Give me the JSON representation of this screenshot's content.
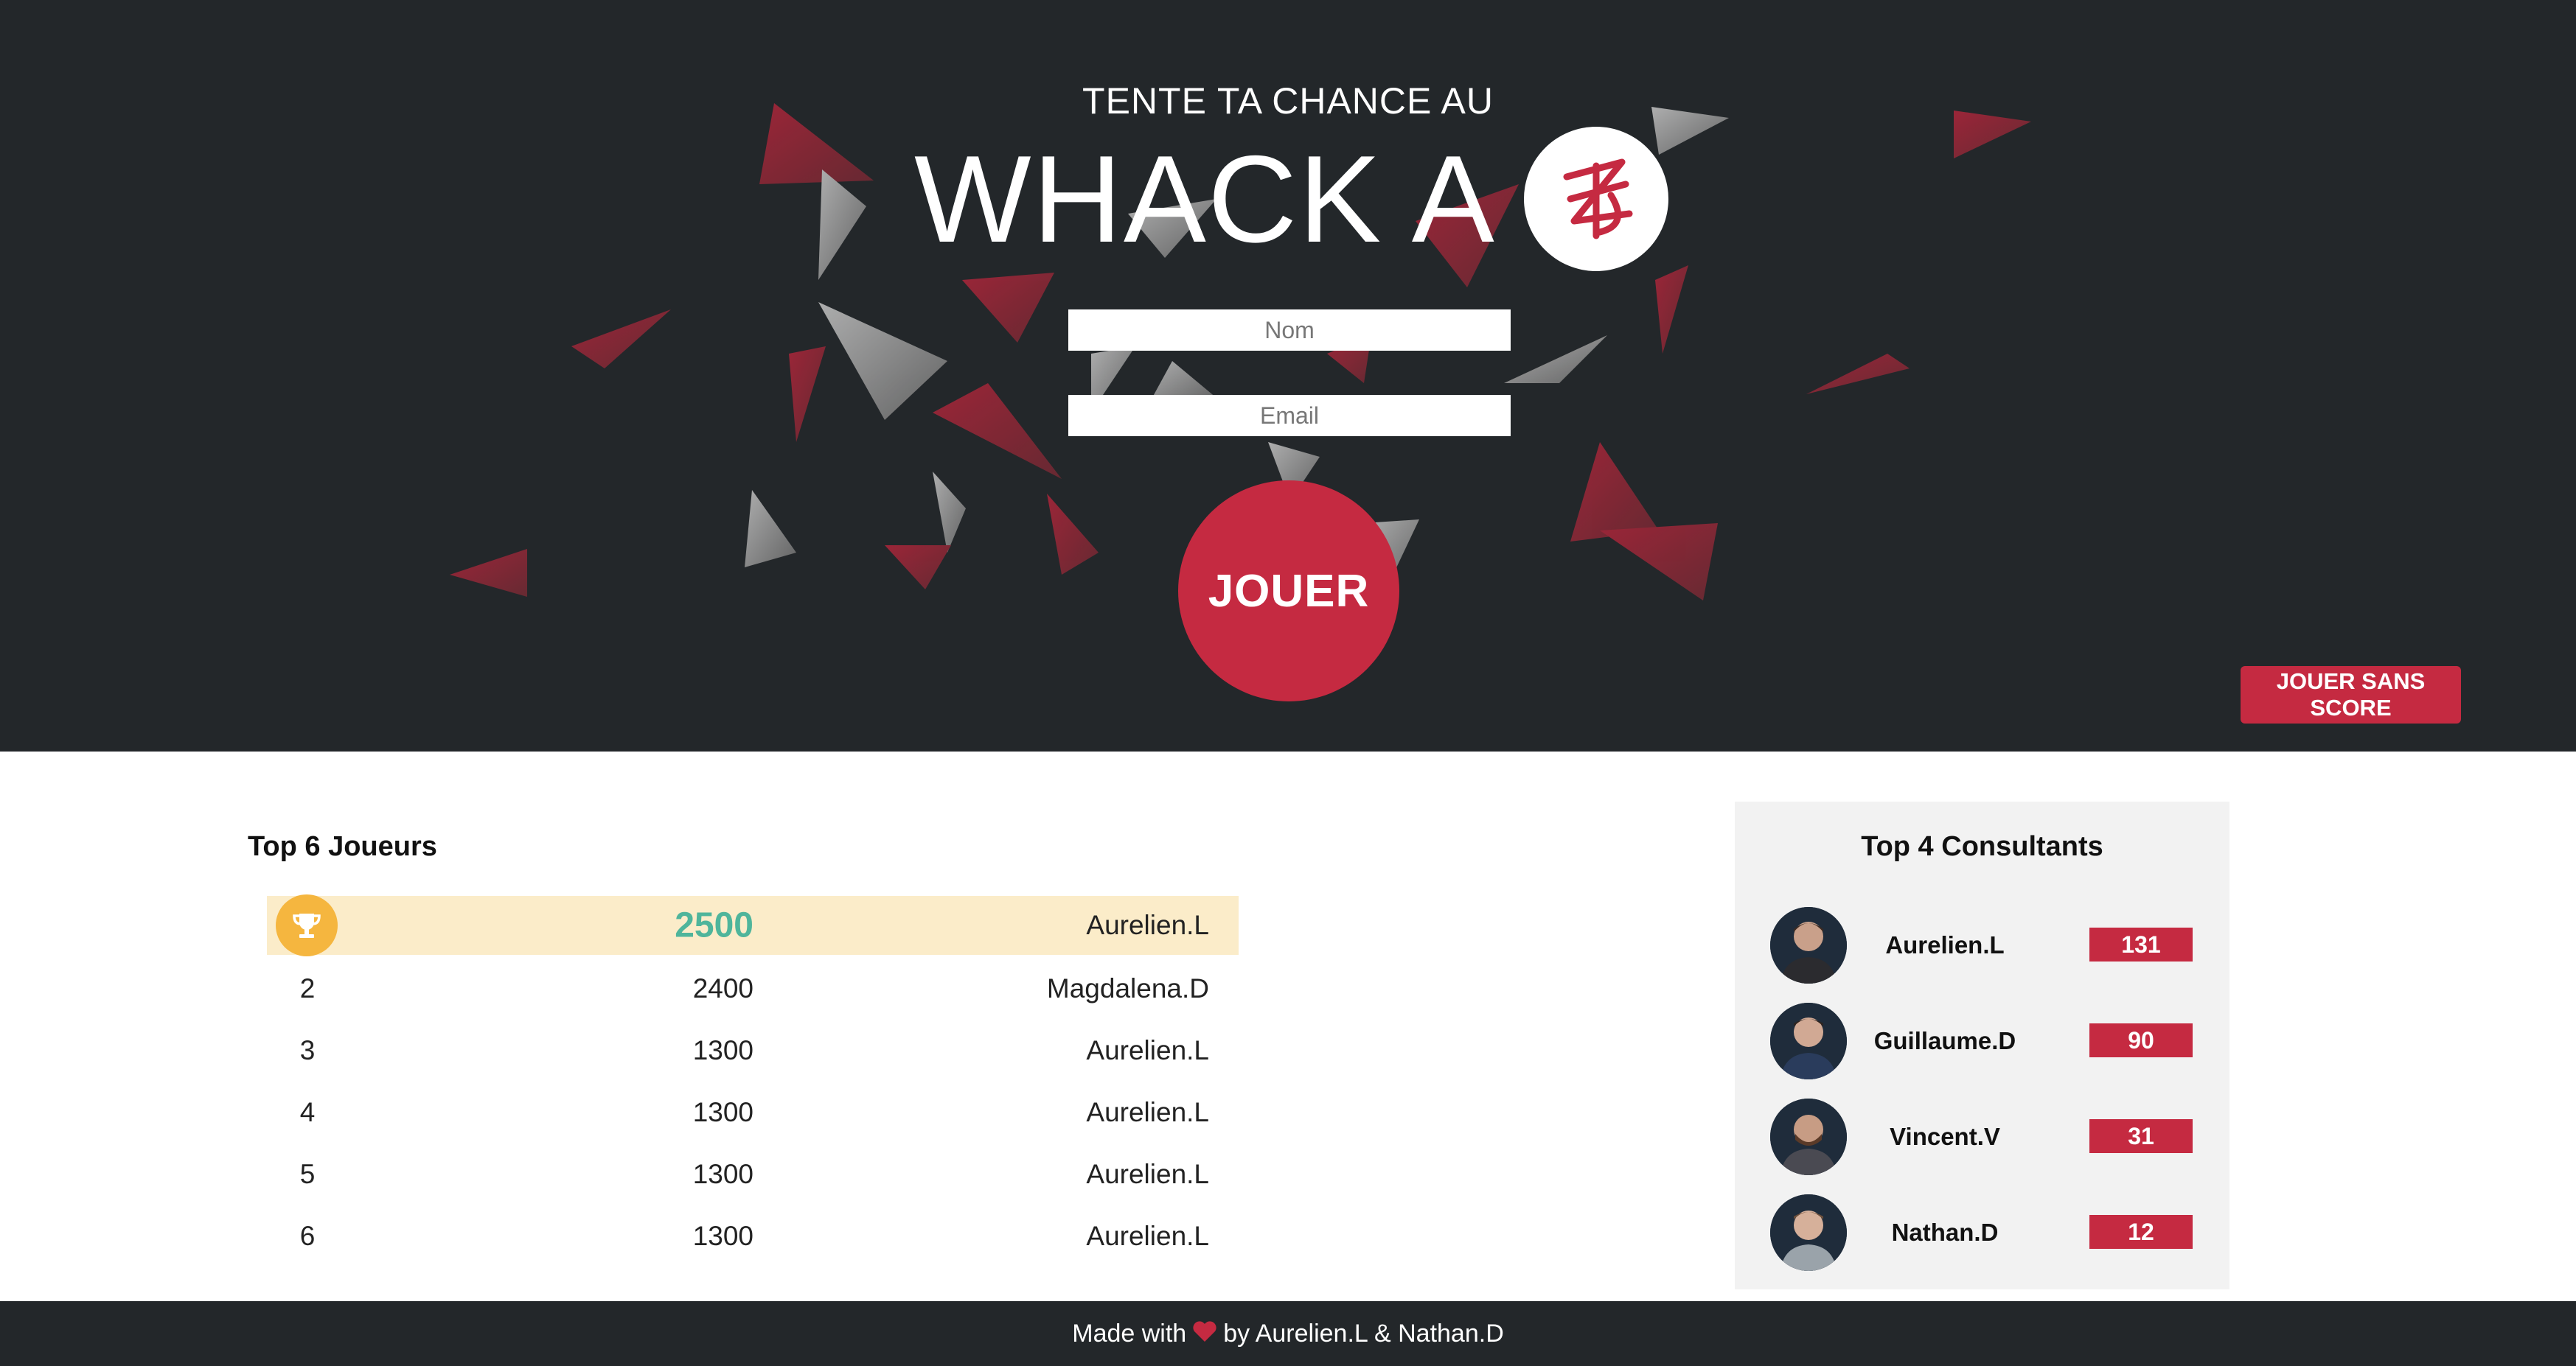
{
  "hero": {
    "subtitle": "TENTE TA CHANCE AU",
    "title": "WHACK A",
    "logo_icon": "zenika-logo-icon",
    "name_placeholder": "Nom",
    "email_placeholder": "Email",
    "play_label": "JOUER",
    "no_score_label": "JOUER SANS SCORE"
  },
  "leaderboard": {
    "title": "Top 6 Joueurs",
    "rows": [
      {
        "rank": "",
        "score": "2500",
        "name": "Aurelien.L",
        "icon": "trophy-icon"
      },
      {
        "rank": "2",
        "score": "2400",
        "name": "Magdalena.D"
      },
      {
        "rank": "3",
        "score": "1300",
        "name": "Aurelien.L"
      },
      {
        "rank": "4",
        "score": "1300",
        "name": "Aurelien.L"
      },
      {
        "rank": "5",
        "score": "1300",
        "name": "Aurelien.L"
      },
      {
        "rank": "6",
        "score": "1300",
        "name": "Aurelien.L"
      }
    ]
  },
  "consultants": {
    "title": "Top 4 Consultants",
    "rows": [
      {
        "name": "Aurelien.L",
        "score": "131"
      },
      {
        "name": "Guillaume.D",
        "score": "90"
      },
      {
        "name": "Vincent.V",
        "score": "31"
      },
      {
        "name": "Nathan.D",
        "score": "12"
      }
    ]
  },
  "footer": {
    "before": "Made with",
    "after": "by Aurelien.L & Nathan.D",
    "heart_icon": "heart-icon"
  },
  "colors": {
    "background_dark": "#23272a",
    "accent_red": "#c52a41",
    "gold": "#f5b63f",
    "highlight_row": "#fbecc9",
    "score_green": "#4fb59b"
  }
}
